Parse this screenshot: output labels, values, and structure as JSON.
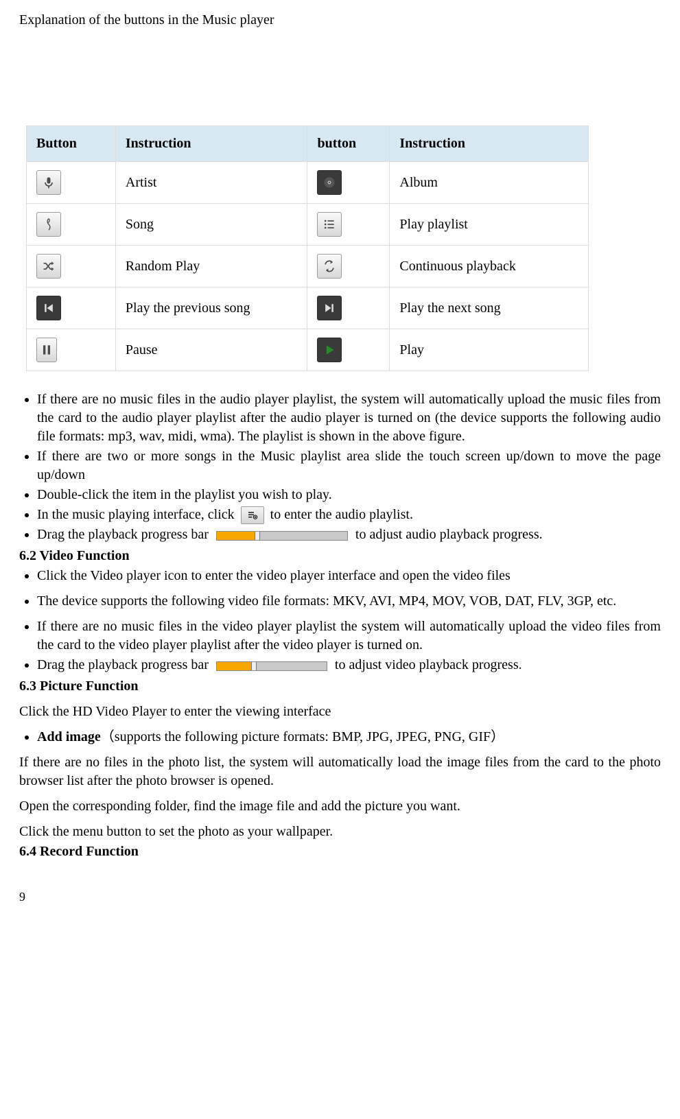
{
  "title": "Explanation of the buttons in the Music player",
  "table": {
    "headers": [
      "Button",
      "Instruction",
      "button",
      "Instruction"
    ],
    "rows": [
      {
        "left_icon": "microphone",
        "left_text": "Artist",
        "right_icon": "disc",
        "right_text": "Album"
      },
      {
        "left_icon": "treble-clef",
        "left_text": "Song",
        "right_icon": "list",
        "right_text": "Play playlist"
      },
      {
        "left_icon": "shuffle",
        "left_text": "Random Play",
        "right_icon": "repeat",
        "right_text": "Continuous playback"
      },
      {
        "left_icon": "prev",
        "left_text": "Play the previous song",
        "right_icon": "next",
        "right_text": "Play the next song"
      },
      {
        "left_icon": "pause",
        "left_text": "Pause",
        "right_icon": "play",
        "right_text": "Play"
      }
    ]
  },
  "bullets_a": [
    "If there are no music files in the audio player playlist, the system will automatically upload the music files from the card to the audio player playlist after the audio player is turned on (the device supports the following audio file formats: mp3, wav, midi, wma). The playlist is shown in the above figure.",
    "If there are two or more songs in the Music playlist area slide the touch screen up/down to move the page up/down",
    "Double-click the item in the playlist you wish to play."
  ],
  "bullet_playlist_pre": "In the music playing interface, click",
  "bullet_playlist_post": "to enter the audio playlist.",
  "bullet_progress_a_pre": "Drag the playback progress bar",
  "bullet_progress_a_post": "to adjust audio playback progress.",
  "section_62": "6.2 Video Function",
  "bullets_b": [
    "Click the Video player icon to enter the video player interface and open the video files"
  ],
  "bullet_vid_formats": "The device supports the following video file formats: MKV, AVI, MP4, MOV, VOB, DAT, FLV, 3GP, etc.",
  "bullet_vid_auto": "If there are no music files in the video player playlist the system will automatically upload the video files from the card to the video player playlist after the video player is turned on.",
  "bullet_progress_b_pre": "Drag the playback progress bar",
  "bullet_progress_b_post": "to adjust video playback progress.",
  "section_63": "6.3 Picture Function",
  "para_pic_enter": "Click the HD Video Player to enter the viewing interface",
  "bullet_add_image_bold": "Add image",
  "bullet_add_image_rest": "（supports the following picture formats: BMP, JPG, JPEG, PNG, GIF）",
  "para_pic_auto": "If there are no files in the photo list, the system will automatically load the image files from the card to the photo browser list after the photo browser is opened.",
  "para_pic_open": "Open the corresponding folder, find the image file and add the picture you want.",
  "para_pic_wall": "Click the menu button to set the photo as your wallpaper.",
  "section_64": "6.4 Record Function",
  "page_number": "9"
}
